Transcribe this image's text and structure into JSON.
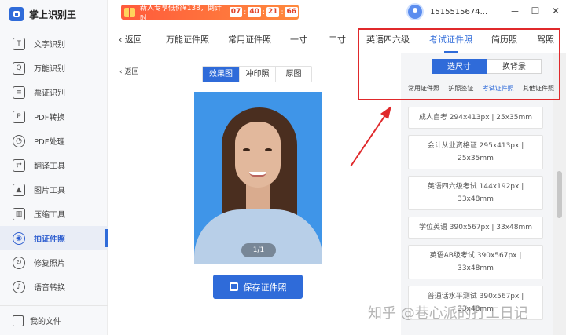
{
  "app": {
    "name": "掌上识别王"
  },
  "sidebar": {
    "items": [
      {
        "label": "文字识别",
        "icon": "T"
      },
      {
        "label": "万能识别",
        "icon": "Q"
      },
      {
        "label": "票证识别",
        "icon": "≡"
      },
      {
        "label": "PDF转换",
        "icon": "P"
      },
      {
        "label": "PDF处理",
        "icon": "◔"
      },
      {
        "label": "翻译工具",
        "icon": "⇄"
      },
      {
        "label": "图片工具",
        "icon": "▲"
      },
      {
        "label": "压缩工具",
        "icon": "▥"
      },
      {
        "label": "拍证件照",
        "icon": "◉"
      },
      {
        "label": "修复照片",
        "icon": "↻"
      },
      {
        "label": "语音转换",
        "icon": "♪"
      }
    ],
    "footer": "我的文件"
  },
  "promo": {
    "text": "新人专享低价¥138，倒计时",
    "countdown": [
      "07",
      "40",
      "21",
      "66"
    ]
  },
  "user": {
    "name": "1515515674..."
  },
  "window": {
    "min": "－",
    "restore": "☐",
    "max": "☐",
    "close": "✕"
  },
  "tabs": {
    "back": "‹ 返回",
    "items": [
      "万能证件照",
      "常用证件照",
      "一寸",
      "二寸",
      "英语四六级",
      "考试证件照",
      "简历照",
      "驾照"
    ],
    "active": "考试证件照"
  },
  "preview": {
    "back": "‹ 返回",
    "modes": [
      "效果图",
      "冲印照",
      "原图"
    ],
    "active_mode": "效果图",
    "pager": "1/1",
    "save_label": "保存证件照"
  },
  "right": {
    "toggle": [
      "选尺寸",
      "换背景"
    ],
    "active_toggle": "选尺寸",
    "subtabs": [
      "常用证件照",
      "护照签证",
      "考试证件照",
      "其他证件照"
    ],
    "active_subtab": "考试证件照",
    "sizes": [
      "成人自考 294x413px | 25x35mm",
      "会计从业资格证 295x413px | 25x35mm",
      "英语四六级考试 144x192px | 33x48mm",
      "学位英语 390x567px | 33x48mm",
      "英语AB级考试 390x567px | 33x48mm",
      "普通话水平测试 390x567px | 33x48mm"
    ]
  },
  "watermark": "知乎 @巷心派的打工日记",
  "colors": {
    "accent": "#2f6bd9",
    "highlight": "#e0292b",
    "photo_bg": "#3f95e8"
  }
}
